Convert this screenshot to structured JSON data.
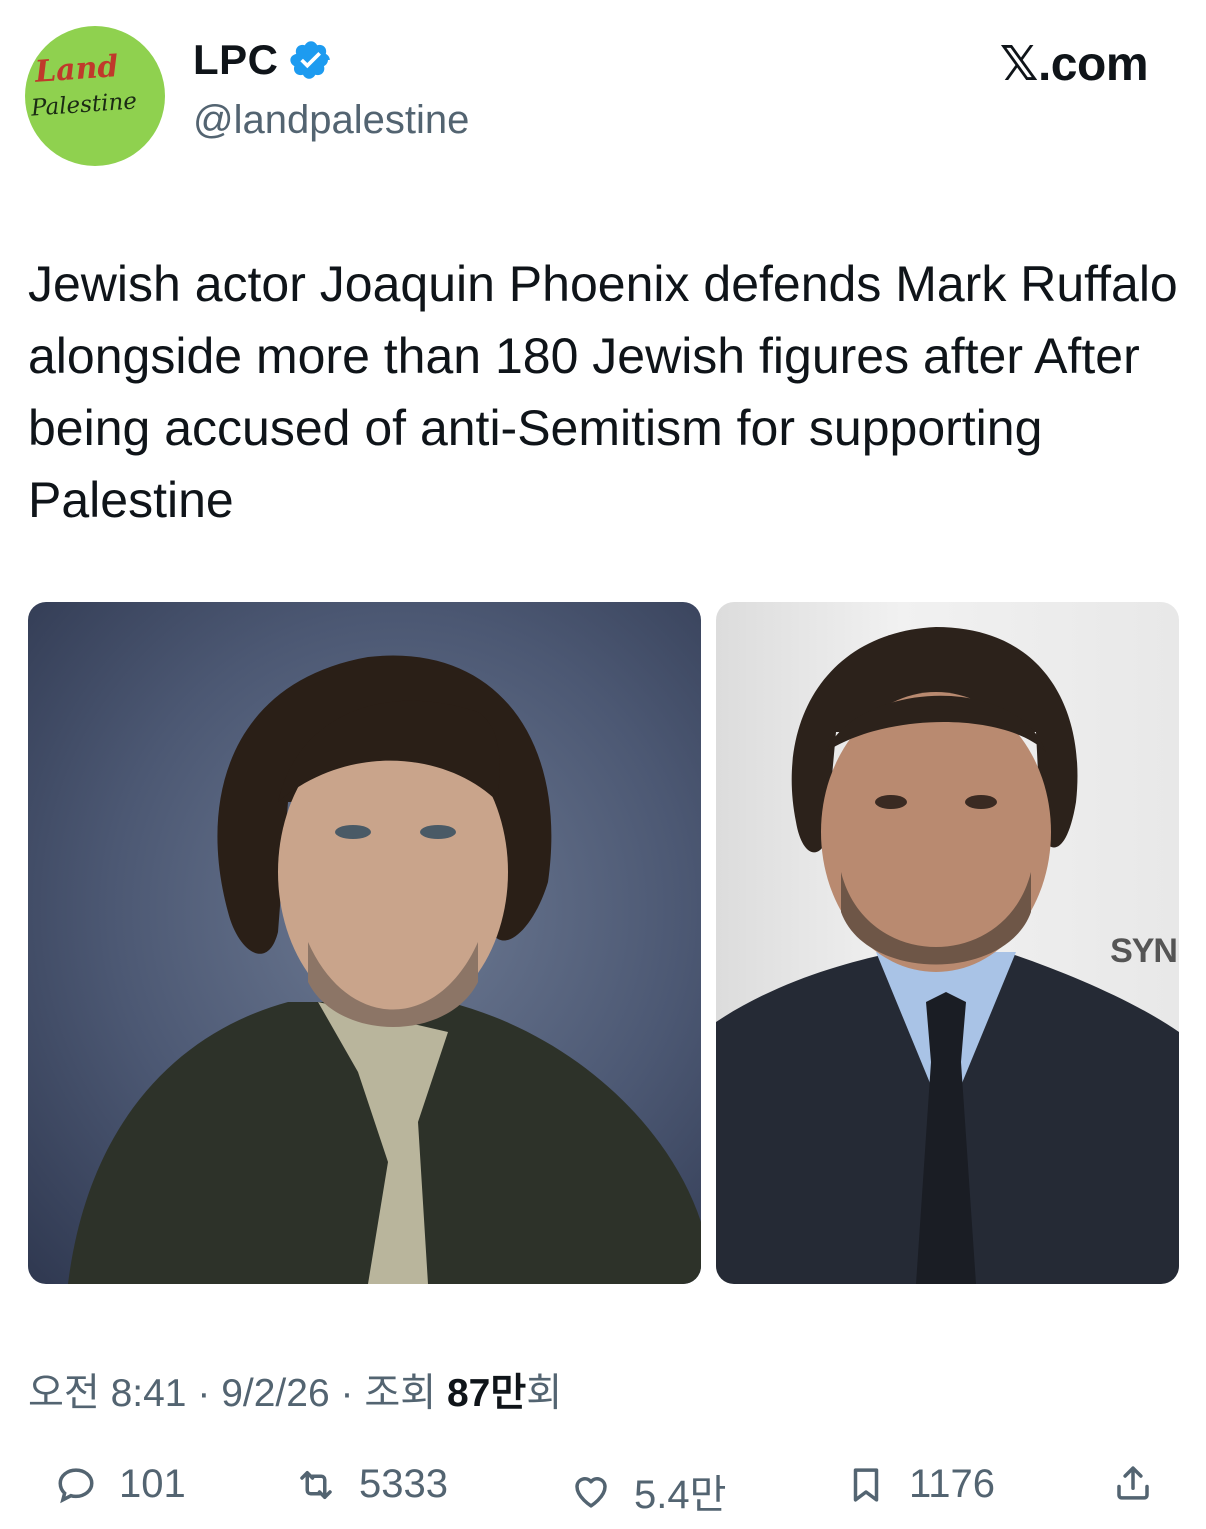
{
  "author": {
    "avatar_text_line1": "Land",
    "avatar_text_line2": "Palestine",
    "display_name": "LPC",
    "handle": "@landpalestine",
    "verified_icon": "verified-badge-icon"
  },
  "brand": "𝕏.com",
  "post": {
    "text": "Jewish actor Joaquin Phoenix defends Mark Ruffalo alongside more than 180 Jewish figures after After being accused of anti-Semitism for supporting Palestine"
  },
  "media": [
    {
      "name": "photo-joaquin-phoenix"
    },
    {
      "name": "photo-mark-ruffalo",
      "backdrop_text": "SYN"
    }
  ],
  "meta": {
    "time": "오전 8:41",
    "date": "9/2/26",
    "views_label": "조회",
    "views_count": "87만",
    "views_suffix": "회",
    "separator": "·"
  },
  "actions": {
    "replies": "101",
    "reposts": "5333",
    "likes": "5.4만",
    "bookmarks": "1176"
  },
  "colors": {
    "text": "#0f1419",
    "secondary": "#536471",
    "verified": "#1d9bf0",
    "avatar_bg": "#8fd14f"
  }
}
